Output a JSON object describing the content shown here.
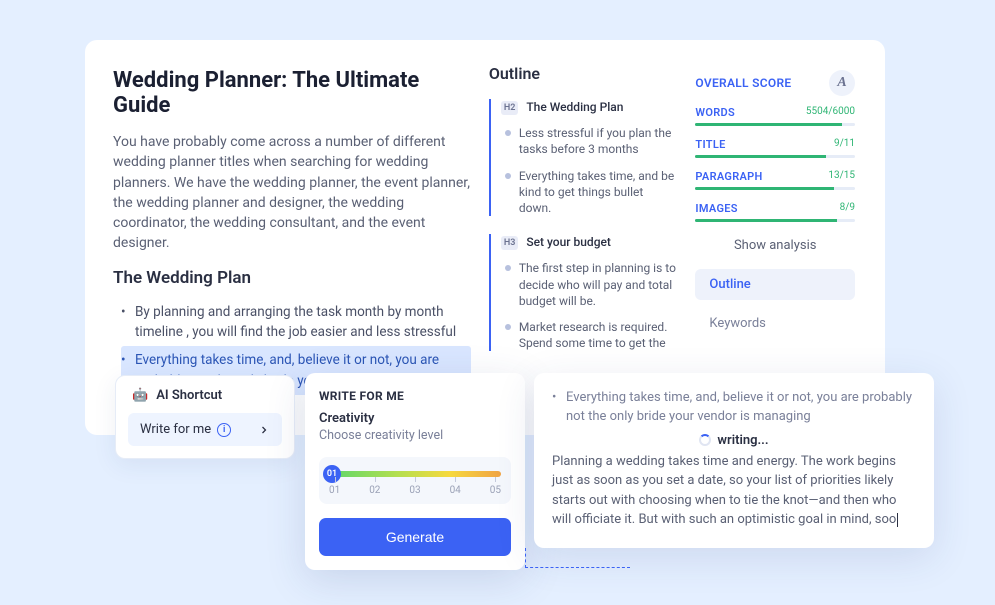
{
  "editor": {
    "title": "Wedding Planner: The Ultimate Guide",
    "intro": "You have probably come across a number of different wedding planner titles when searching for wedding planners. We have the wedding planner, the event planner, the wedding planner and designer, the wedding coordinator, the wedding consultant, and the event designer.",
    "h2": "The Wedding Plan",
    "bullets": [
      "By planning and arranging the task month by month timeline , you will find the job easier and less stressful",
      "Everything takes time, and, believe it or not, you are probably not the only bride your vendor is managing"
    ]
  },
  "outline": {
    "heading": "Outline",
    "groups": [
      {
        "level": "H2",
        "title": "The Wedding Plan",
        "items": [
          "Less stressful if you plan the tasks before 3 months",
          "Everything takes time, and be kind to get things bullet down."
        ]
      },
      {
        "level": "H3",
        "title": "Set your budget",
        "items": [
          "The first step in planning is to decide who will pay and total budget will be.",
          "Market research is required. Spend some time to get the"
        ]
      }
    ]
  },
  "scorer": {
    "title": "OVERALL SCORE",
    "icon": "A",
    "metrics": [
      {
        "label": "WORDS",
        "value": "5504/6000",
        "pct": 92
      },
      {
        "label": "TITLE",
        "value": "9/11",
        "pct": 82
      },
      {
        "label": "PARAGRAPH",
        "value": "13/15",
        "pct": 87
      },
      {
        "label": "IMAGES",
        "value": "8/9",
        "pct": 89
      }
    ],
    "show": "Show analysis",
    "tab_outline": "Outline",
    "tab_keywords": "Keywords"
  },
  "shortcut": {
    "title": "AI Shortcut",
    "action": "Write for me"
  },
  "wfm": {
    "caption": "WRITE FOR ME",
    "label1": "Creativity",
    "label2": "Choose creativity level",
    "thumb": "01",
    "ticks": [
      "01",
      "02",
      "03",
      "04",
      "05"
    ],
    "generate": "Generate"
  },
  "preview": {
    "bullet": "Everything takes time, and, believe it or not, you are probably not the only bride your vendor is managing",
    "status": "writing...",
    "body": "Planning a wedding takes time and energy. The work begins just as soon as you set a date, so your list of priorities likely starts out with choosing when to tie the knot—and then who will officiate it. But with such an optimistic goal in mind, soo"
  }
}
